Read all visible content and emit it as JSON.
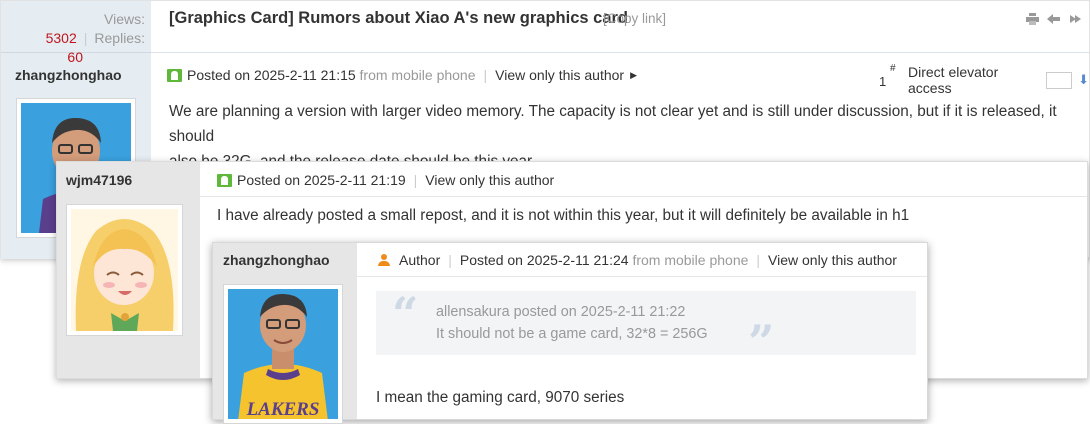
{
  "thread": {
    "views_label": "Views:",
    "views": "5302",
    "replies_label": "Replies:",
    "replies": "60",
    "title": "[Graphics Card] Rumors about Xiao A's new graphics card",
    "copy_link": "[Copy link]"
  },
  "post1": {
    "author": "zhangzhonghao",
    "posted": "Posted on 2025-2-11 21:15",
    "source": "from mobile phone",
    "view_only": "View only this author",
    "floor_number": "1",
    "floor_mark": "#",
    "elevator": "Direct elevator access",
    "line1": "We are planning a version with larger video memory. The capacity is not clear yet and is still under discussion, but if it is released, it should",
    "line2": "also be 32G, and the release date should be this year."
  },
  "post2": {
    "author": "wjm47196",
    "posted": "Posted on 2025-2-11 21:19",
    "view_only": "View only this author",
    "body": "I have already posted a small repost, and it is not within this year, but it will definitely be available in h1"
  },
  "post3": {
    "author": "zhangzhonghao",
    "badge": "Author",
    "posted": "Posted on 2025-2-11 21:24",
    "source": "from mobile phone",
    "view_only": "View only this author",
    "quote_header": "allensakura posted on 2025-2-11 21:22",
    "quote_text": "It should not be a game card, 32*8 = 256G",
    "body": "I mean the gaming card, 9070 series",
    "jersey_text": "LAKERS"
  },
  "colors": {
    "accent_red": "#c1151e",
    "online_green": "#5fb83a",
    "author_orange": "#f08a1a",
    "sidebar_blue": "#e5edf2"
  },
  "icons": [
    "print-icon",
    "back-icon",
    "more-icon",
    "online-status-icon",
    "chevron-right-icon",
    "down-arrow-icon",
    "author-icon",
    "quote-open-icon",
    "quote-close-icon"
  ]
}
